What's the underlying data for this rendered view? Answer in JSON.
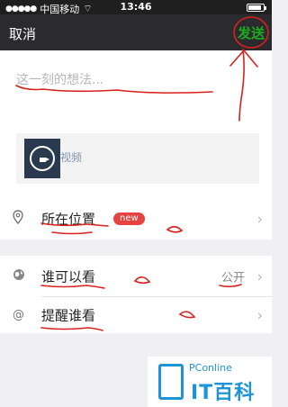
{
  "statusbar": {
    "carrier": "中国移动",
    "time": "13:46",
    "battery_level": 0.78
  },
  "navbar": {
    "cancel_label": "取消",
    "send_label": "发送"
  },
  "compose": {
    "placeholder": "这一刻的想法...",
    "attachment": {
      "type": "video",
      "label": "视频",
      "icon": "video-camera-icon"
    }
  },
  "options": {
    "location": {
      "label": "所在位置",
      "badge": "new",
      "icon": "location-pin-icon"
    },
    "visibility": {
      "label": "谁可以看",
      "value": "公开",
      "icon": "globe-icon"
    },
    "mention": {
      "label": "提醒谁看",
      "icon": "at-icon"
    }
  },
  "watermark": {
    "brand": "PConline",
    "name": "IT百科"
  },
  "colors": {
    "send_green": "#1aad19",
    "badge_red": "#e64340",
    "annotation_red": "#d8201c",
    "watermark_blue": "#1e93d6"
  }
}
